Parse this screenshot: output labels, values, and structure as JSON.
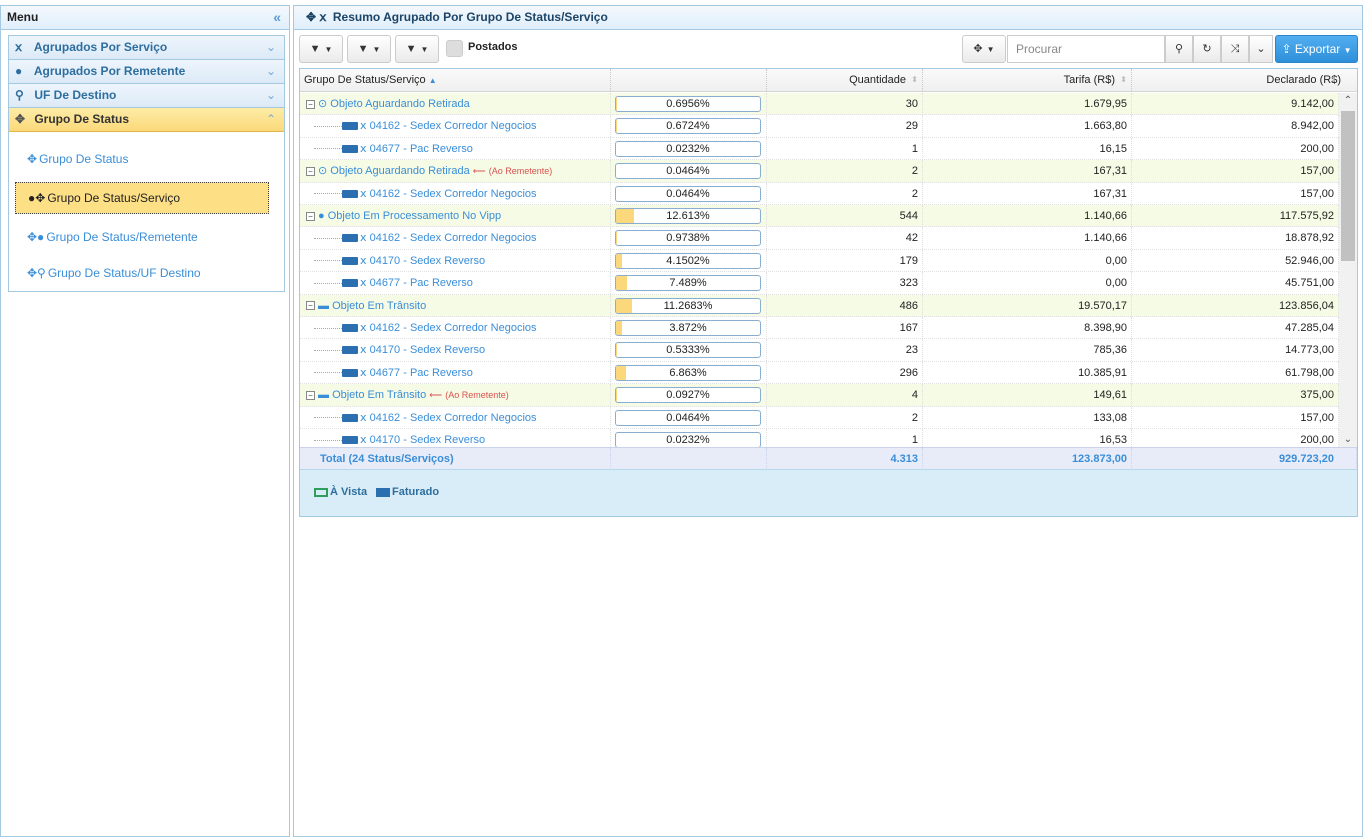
{
  "menu": {
    "title": "Menu",
    "collapse_icon": "«",
    "accordion": [
      {
        "label": "Agrupados Por Serviço",
        "icon": "service-icon"
      },
      {
        "label": "Agrupados Por Remetente",
        "icon": "user-icon"
      },
      {
        "label": "UF De Destino",
        "icon": "map-pin-icon"
      },
      {
        "label": "Grupo De Status",
        "icon": "move-icon"
      }
    ],
    "sub_items": [
      {
        "label": "Grupo De Status"
      },
      {
        "label": "Grupo De Status/Serviço"
      },
      {
        "label": "Grupo De Status/Remetente"
      },
      {
        "label": "Grupo De Status/UF Destino"
      }
    ]
  },
  "main": {
    "title": "Resumo Agrupado Por Grupo De Status/Serviço"
  },
  "toolbar": {
    "postados_label": "Postados",
    "search_placeholder": "Procurar",
    "export_label": "Exportar"
  },
  "grid": {
    "headers": {
      "name": "Grupo De Status/Serviço",
      "qty": "Quantidade",
      "tarifa": "Tarifa (R$)",
      "declarado": "Declarado (R$)"
    },
    "rows": [
      {
        "type": "group",
        "icon": "clock-icon",
        "name": "Objeto Aguardando Retirada",
        "tag": "",
        "pct": "0.6956%",
        "fill": 0.6956,
        "qty": "30",
        "tarifa": "1.679,95",
        "declarado": "9.142,00"
      },
      {
        "type": "child",
        "name": "04162 - Sedex Corredor Negocios",
        "pct": "0.6724%",
        "fill": 0.6724,
        "qty": "29",
        "tarifa": "1.663,80",
        "declarado": "8.942,00"
      },
      {
        "type": "child",
        "name": "04677 - Pac Reverso",
        "pct": "0.0232%",
        "fill": 0.0232,
        "qty": "1",
        "tarifa": "16,15",
        "declarado": "200,00"
      },
      {
        "type": "group",
        "icon": "clock-icon",
        "name": "Objeto Aguardando Retirada",
        "tag": "(Ao Remetente)",
        "pct": "0.0464%",
        "fill": 0.0464,
        "qty": "2",
        "tarifa": "167,31",
        "declarado": "157,00"
      },
      {
        "type": "child",
        "name": "04162 - Sedex Corredor Negocios",
        "pct": "0.0464%",
        "fill": 0.0464,
        "qty": "2",
        "tarifa": "167,31",
        "declarado": "157,00"
      },
      {
        "type": "group",
        "icon": "globe-icon",
        "name": "Objeto Em Processamento No Vipp",
        "tag": "",
        "pct": "12.613%",
        "fill": 12.613,
        "qty": "544",
        "tarifa": "1.140,66",
        "declarado": "117.575,92"
      },
      {
        "type": "child",
        "name": "04162 - Sedex Corredor Negocios",
        "pct": "0.9738%",
        "fill": 0.9738,
        "qty": "42",
        "tarifa": "1.140,66",
        "declarado": "18.878,92"
      },
      {
        "type": "child",
        "name": "04170 - Sedex Reverso",
        "pct": "4.1502%",
        "fill": 4.1502,
        "qty": "179",
        "tarifa": "0,00",
        "declarado": "52.946,00"
      },
      {
        "type": "child",
        "name": "04677 - Pac Reverso",
        "pct": "7.489%",
        "fill": 7.489,
        "qty": "323",
        "tarifa": "0,00",
        "declarado": "45.751,00"
      },
      {
        "type": "group",
        "icon": "truck-icon",
        "name": "Objeto Em Trânsito",
        "tag": "",
        "pct": "11.2683%",
        "fill": 11.2683,
        "qty": "486",
        "tarifa": "19.570,17",
        "declarado": "123.856,04"
      },
      {
        "type": "child",
        "name": "04162 - Sedex Corredor Negocios",
        "pct": "3.872%",
        "fill": 3.872,
        "qty": "167",
        "tarifa": "8.398,90",
        "declarado": "47.285,04"
      },
      {
        "type": "child",
        "name": "04170 - Sedex Reverso",
        "pct": "0.5333%",
        "fill": 0.5333,
        "qty": "23",
        "tarifa": "785,36",
        "declarado": "14.773,00"
      },
      {
        "type": "child",
        "name": "04677 - Pac Reverso",
        "pct": "6.863%",
        "fill": 6.863,
        "qty": "296",
        "tarifa": "10.385,91",
        "declarado": "61.798,00"
      },
      {
        "type": "group",
        "icon": "truck-icon",
        "name": "Objeto Em Trânsito",
        "tag": "(Ao Remetente)",
        "pct": "0.0927%",
        "fill": 0.0927,
        "qty": "4",
        "tarifa": "149,61",
        "declarado": "375,00"
      },
      {
        "type": "child",
        "name": "04162 - Sedex Corredor Negocios",
        "pct": "0.0464%",
        "fill": 0.0464,
        "qty": "2",
        "tarifa": "133,08",
        "declarado": "157,00"
      },
      {
        "type": "child",
        "name": "04170 - Sedex Reverso",
        "pct": "0.0232%",
        "fill": 0.0232,
        "qty": "1",
        "tarifa": "16,53",
        "declarado": "200,00"
      }
    ],
    "footer": {
      "label": "Total (24 Status/Serviços)",
      "qty": "4.313",
      "tarifa": "123.873,00",
      "declarado": "929.723,20"
    }
  },
  "legend": {
    "a_vista": "À Vista",
    "faturado": "Faturado"
  },
  "colors": {
    "accent": "#3a8ed8",
    "active_menu": "#fddf86",
    "group_row": "#f6fbe6",
    "bar_fill": "#fcd87c",
    "export_button": "#2e8fd9"
  }
}
